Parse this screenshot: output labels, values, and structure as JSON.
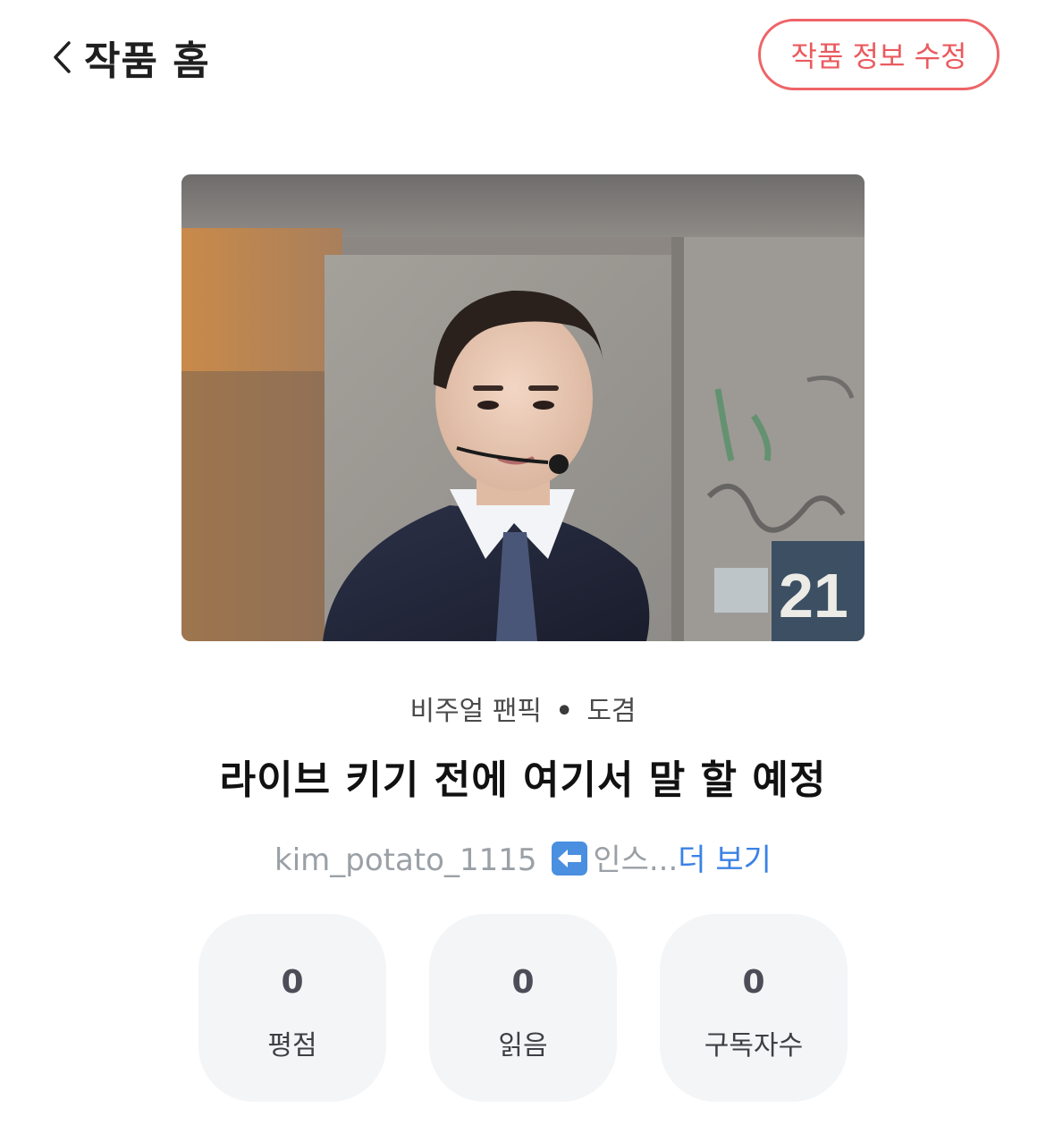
{
  "header": {
    "back_label": "작품 홈",
    "back_icon": "chevron-left-icon",
    "edit_button_label": "작품 정보 수정",
    "accent_color": "#ea5a5f"
  },
  "work": {
    "category": "비주얼 팬픽",
    "separator": "•",
    "character": "도겸",
    "title": "라이브 키기 전에 여기서 말 할 예정",
    "description_text": "kim_potato_1115",
    "description_emoji": "left-arrow-emoji",
    "description_suffix": "인스...",
    "more_label": "더 보기",
    "cover_number": "21",
    "link_color": "#3b82e6"
  },
  "stats": [
    {
      "value": "0",
      "label": "평점"
    },
    {
      "value": "0",
      "label": "읽음"
    },
    {
      "value": "0",
      "label": "구독자수"
    }
  ]
}
